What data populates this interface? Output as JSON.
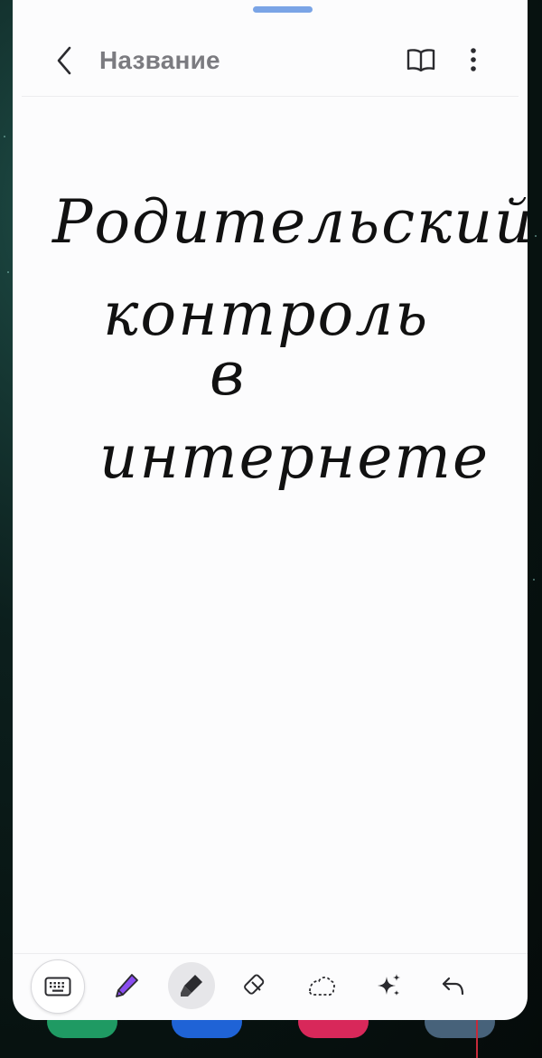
{
  "note": {
    "title": "Название",
    "handwriting": {
      "line1": "Родительский",
      "line2": "контроль",
      "line3": "в",
      "line4": "интернете"
    }
  },
  "header": {
    "back_icon": "chevron-left-icon",
    "reader_icon": "book-open-icon",
    "more_icon": "more-vert-icon"
  },
  "toolbar": {
    "tools": [
      {
        "name": "keyboard",
        "icon": "keyboard-icon"
      },
      {
        "name": "pen",
        "icon": "pen-icon",
        "color": "#8a4df0"
      },
      {
        "name": "highlighter",
        "icon": "highlighter-icon",
        "color": "#2b2b2f",
        "selected": true
      },
      {
        "name": "eraser",
        "icon": "eraser-icon"
      },
      {
        "name": "lasso",
        "icon": "lasso-icon"
      },
      {
        "name": "ai-assist",
        "icon": "sparkles-icon"
      },
      {
        "name": "undo",
        "icon": "undo-icon"
      }
    ]
  },
  "colors": {
    "sheet": "#fcfcfd",
    "title_text": "#7b7b80",
    "drag_handle": "#7aa4e6",
    "ink": "#111111"
  }
}
